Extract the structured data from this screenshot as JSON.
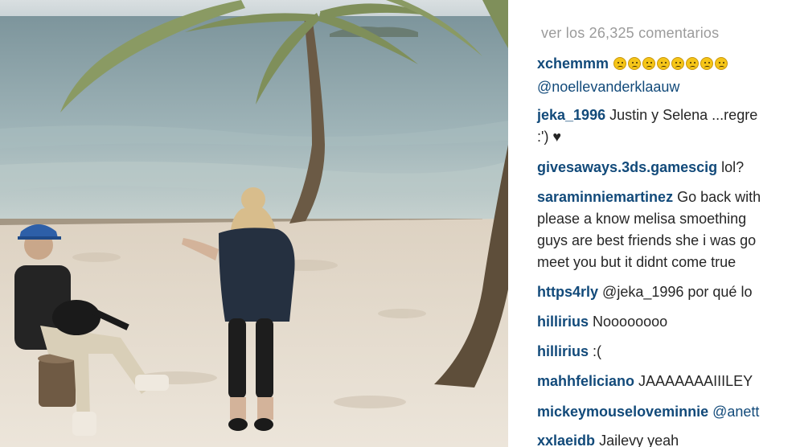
{
  "post": {
    "photo_description": "",
    "view_all_comments": "ver los 26,325 comentarios"
  },
  "comments": [
    {
      "user": "xchemmm",
      "emoji_count": 8,
      "emoji_icon": "sad-face-emoji",
      "text": "",
      "line2": "@noellevanderklaauw",
      "line2_is_link": true
    },
    {
      "user": "jeka_1996",
      "text": "Justin y Selena ...regre",
      "line2": ":') ♥",
      "line2_is_link": false
    },
    {
      "user": "givesaways.3ds.gamescig",
      "text": "lol?"
    },
    {
      "user": "saraminniemartinez",
      "text": "Go back with",
      "line2": "please a know melisa smoething",
      "line3": "guys are best friends she i was go",
      "line4": "meet you but it didnt come true"
    },
    {
      "user": "https4rly",
      "text": "@jeka_1996 por qué lo"
    },
    {
      "user": "hillirius",
      "text": "Noooooooo"
    },
    {
      "user": "hillirius",
      "text": ":("
    },
    {
      "user": "mahhfeliciano",
      "text": "JAAAAAAAIIILEY"
    },
    {
      "user": "mickeymouseloveminnie",
      "text": "@anett"
    },
    {
      "user": "xxlaeidb",
      "text": "Jailevy yeah"
    }
  ],
  "colors": {
    "username": "#124a7a",
    "text": "#262626",
    "muted": "#9b9b9b",
    "sand": "#e6ddd0",
    "sea": "#8fa6ad"
  }
}
